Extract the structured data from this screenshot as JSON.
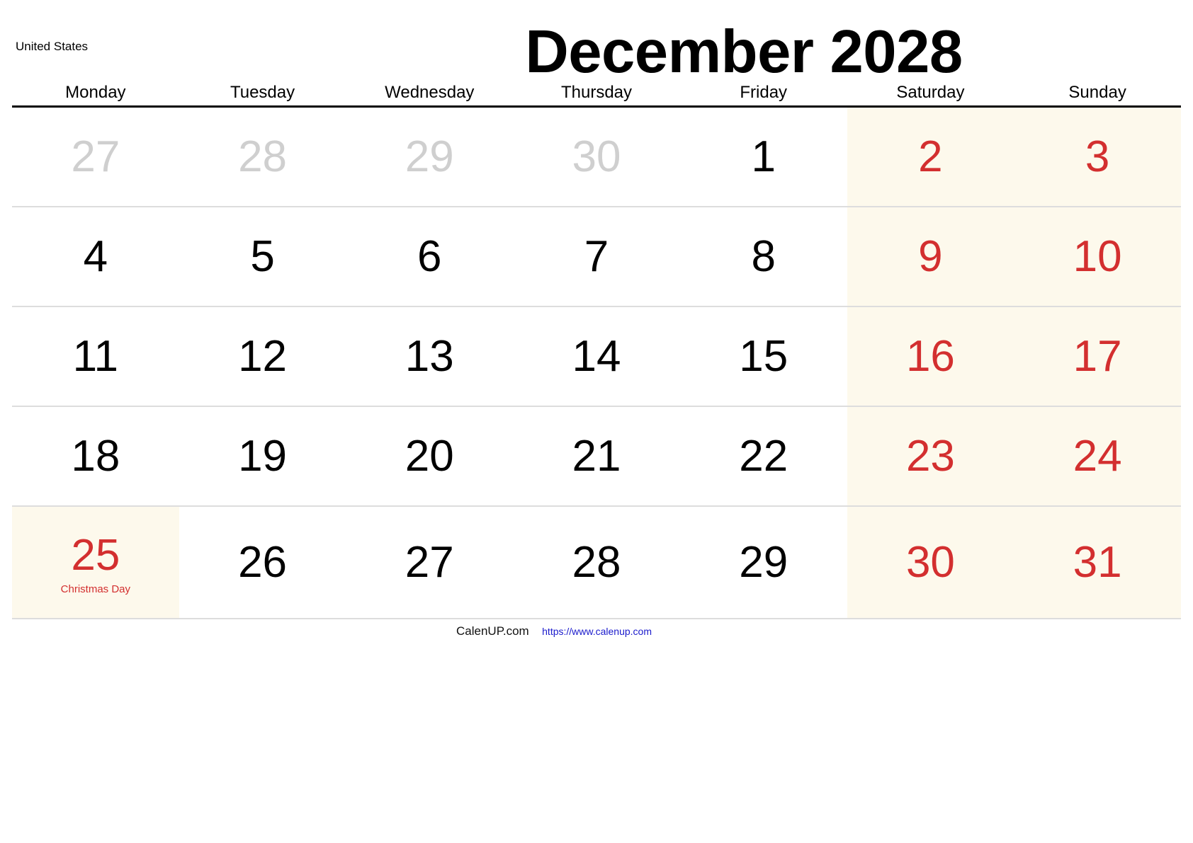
{
  "header": {
    "country": "United States",
    "title": "December 2028"
  },
  "weekdays": [
    "Monday",
    "Tuesday",
    "Wednesday",
    "Thursday",
    "Friday",
    "Saturday",
    "Sunday"
  ],
  "weeks": [
    [
      {
        "day": "27",
        "type": "other"
      },
      {
        "day": "28",
        "type": "other"
      },
      {
        "day": "29",
        "type": "other"
      },
      {
        "day": "30",
        "type": "other"
      },
      {
        "day": "1",
        "type": "normal"
      },
      {
        "day": "2",
        "type": "weekend"
      },
      {
        "day": "3",
        "type": "weekend"
      }
    ],
    [
      {
        "day": "4",
        "type": "normal"
      },
      {
        "day": "5",
        "type": "normal"
      },
      {
        "day": "6",
        "type": "normal"
      },
      {
        "day": "7",
        "type": "normal"
      },
      {
        "day": "8",
        "type": "normal"
      },
      {
        "day": "9",
        "type": "weekend"
      },
      {
        "day": "10",
        "type": "weekend"
      }
    ],
    [
      {
        "day": "11",
        "type": "normal"
      },
      {
        "day": "12",
        "type": "normal"
      },
      {
        "day": "13",
        "type": "normal"
      },
      {
        "day": "14",
        "type": "normal"
      },
      {
        "day": "15",
        "type": "normal"
      },
      {
        "day": "16",
        "type": "weekend"
      },
      {
        "day": "17",
        "type": "weekend"
      }
    ],
    [
      {
        "day": "18",
        "type": "normal"
      },
      {
        "day": "19",
        "type": "normal"
      },
      {
        "day": "20",
        "type": "normal"
      },
      {
        "day": "21",
        "type": "normal"
      },
      {
        "day": "22",
        "type": "normal"
      },
      {
        "day": "23",
        "type": "weekend"
      },
      {
        "day": "24",
        "type": "weekend"
      }
    ],
    [
      {
        "day": "25",
        "type": "holiday",
        "label": "Christmas Day"
      },
      {
        "day": "26",
        "type": "normal"
      },
      {
        "day": "27",
        "type": "normal"
      },
      {
        "day": "28",
        "type": "normal"
      },
      {
        "day": "29",
        "type": "normal"
      },
      {
        "day": "30",
        "type": "weekend"
      },
      {
        "day": "31",
        "type": "weekend"
      }
    ]
  ],
  "footer": {
    "brand": "CalenUP.com",
    "url": "https://www.calenup.com"
  },
  "colors": {
    "weekend_text": "#d32f2f",
    "weekend_background": "#fdf9ec",
    "other_month_text": "#cfcfcf",
    "link": "#1a1acc"
  }
}
